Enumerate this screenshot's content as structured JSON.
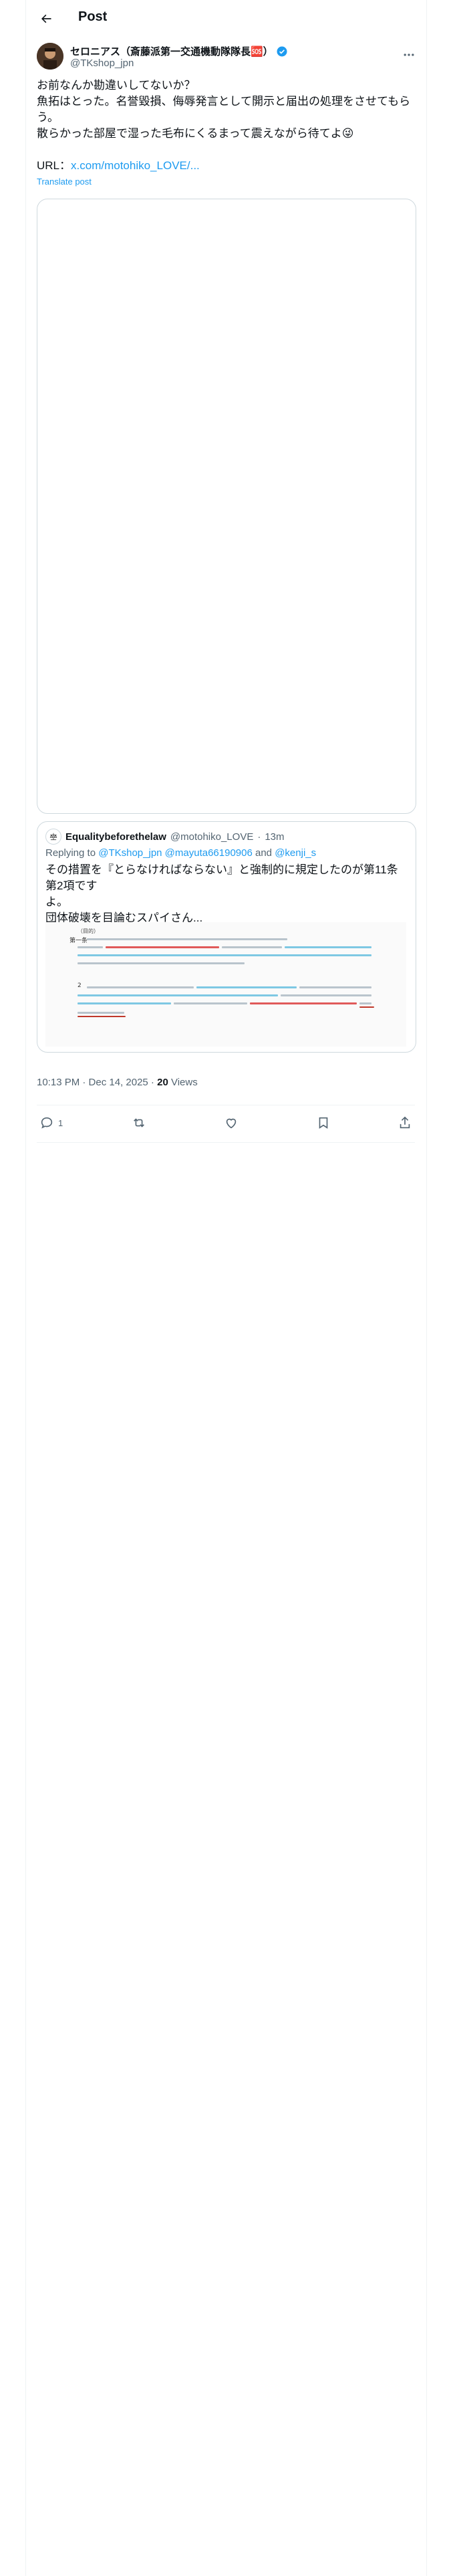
{
  "header": {
    "title": "Post"
  },
  "author": {
    "name": "セロニアス（斎藤派第一交通機動隊隊長🆘）",
    "handle": "@TKshop_jpn"
  },
  "post": {
    "lines": [
      "お前なんか勘違いしてないか？",
      "魚拓はとった。名誉毀損、侮辱発言として開示と届出の処理をさせてもら",
      "う。",
      "散らかった部屋で湿った毛布にくるまって震えながら待てよ😜"
    ],
    "url_label": "URL：",
    "url": "x.com/motohiko_LOVE/...",
    "translate": "Translate post"
  },
  "quote": {
    "name": "Equalitybeforethelaw",
    "handle": "@motohiko_LOVE",
    "dot": "·",
    "time": "13m",
    "replying_prefix": "Replying to ",
    "replying_to": "@TKshop_jpn @mayuta66190906",
    "replying_and": " and ",
    "replying_last": "@kenji_s",
    "lines": [
      "その措置を『とらなければならない』と強制的に規定したのが第11条第2項です",
      "よ。",
      "団体破壊を目論むスパイさん..."
    ],
    "doc": {
      "title": "（目的）",
      "art1": "第一条",
      "art2": "2"
    }
  },
  "meta": {
    "time": "10:13 PM · Dec 14, 2025 · ",
    "views": "20",
    "views_label": " Views"
  },
  "actions": {
    "reply_count": "1"
  },
  "colors": {
    "link": "#1d9bf0",
    "muted": "#536471",
    "border": "#cfd9de",
    "highlight_blue": "#7ec8e3",
    "highlight_red": "#e05a5a"
  }
}
